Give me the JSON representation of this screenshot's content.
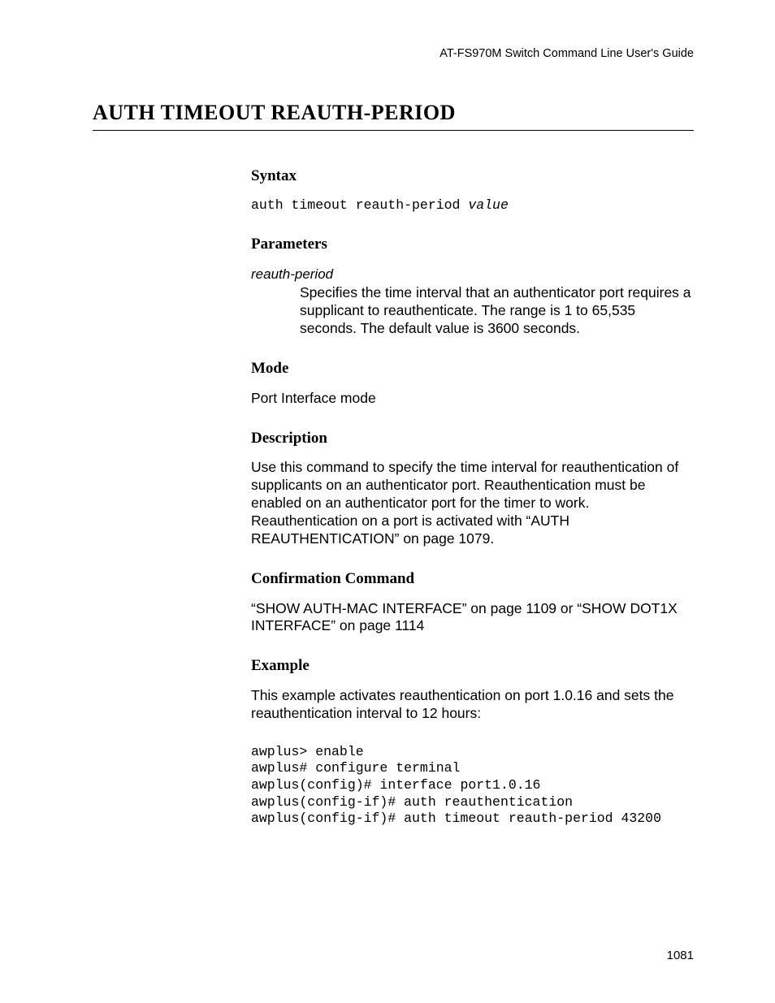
{
  "header": {
    "running_head": "AT-FS970M Switch Command Line User's Guide"
  },
  "title": "AUTH TIMEOUT REAUTH-PERIOD",
  "sections": {
    "syntax": {
      "heading": "Syntax",
      "command": "auth timeout reauth-period ",
      "arg": "value"
    },
    "parameters": {
      "heading": "Parameters",
      "name": "reauth-period",
      "desc": "Specifies the time interval that an authenticator port requires a supplicant to reauthenticate. The range is 1 to 65,535 seconds. The default value is 3600 seconds."
    },
    "mode": {
      "heading": "Mode",
      "text": "Port Interface mode"
    },
    "description": {
      "heading": "Description",
      "text": "Use this command to specify the time interval for reauthentication of supplicants on an authenticator port. Reauthentication must be enabled on an authenticator port for the timer to work. Reauthentication on a port is activated with “AUTH REAUTHENTICATION” on page 1079."
    },
    "confirmation": {
      "heading": "Confirmation Command",
      "text": "“SHOW AUTH-MAC INTERFACE” on page 1109 or “SHOW DOT1X INTERFACE” on page 1114"
    },
    "example": {
      "heading": "Example",
      "intro": "This example activates reauthentication on port 1.0.16 and sets the reauthentication interval to 12 hours:",
      "code": "awplus> enable\nawplus# configure terminal\nawplus(config)# interface port1.0.16\nawplus(config-if)# auth reauthentication\nawplus(config-if)# auth timeout reauth-period 43200"
    }
  },
  "footer": {
    "page_number": "1081"
  }
}
